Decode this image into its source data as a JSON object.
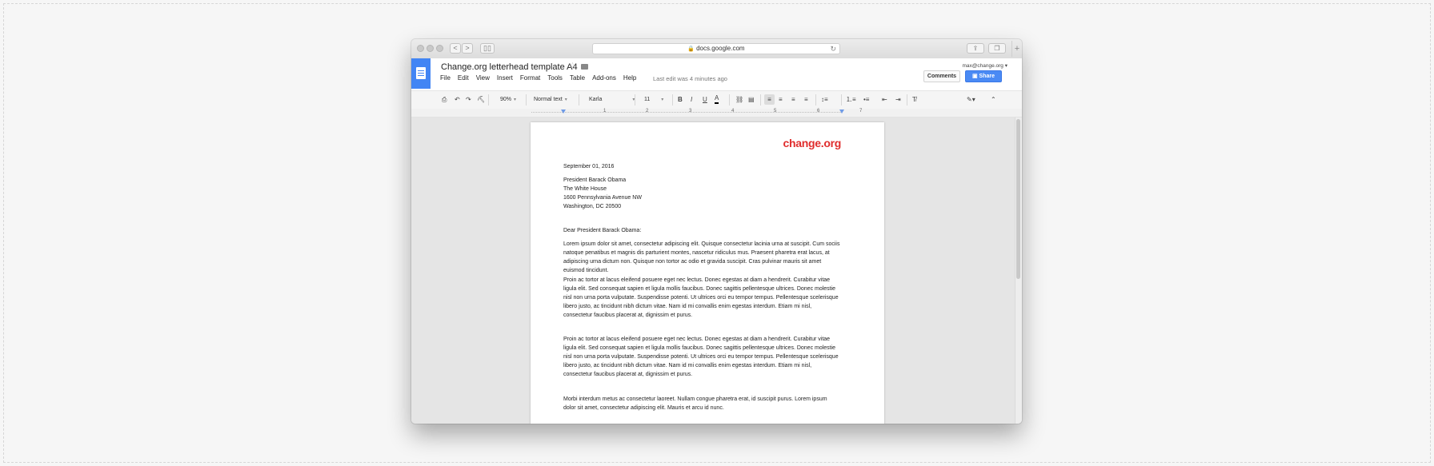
{
  "browser": {
    "url": "docs.google.com",
    "back_label": "<",
    "forward_label": ">"
  },
  "document": {
    "title": "Change.org letterhead template A4",
    "menu": [
      "File",
      "Edit",
      "View",
      "Insert",
      "Format",
      "Tools",
      "Table",
      "Add-ons",
      "Help"
    ],
    "last_edit": "Last edit was 4 minutes ago",
    "account": "max@change.org",
    "comments_label": "Comments",
    "share_label": "Share"
  },
  "toolbar": {
    "zoom": "90%",
    "style": "Normal text",
    "font": "Karla",
    "size": "11",
    "bold": "B",
    "italic": "I",
    "underline": "U",
    "text_color": "A"
  },
  "ruler": {
    "numbers": [
      "1",
      "2",
      "3",
      "4",
      "5",
      "6",
      "7"
    ]
  },
  "letter": {
    "brand": "change.org",
    "date": "September 01, 2016",
    "address": [
      "President Barack Obama",
      "The White House",
      "1600 Pennsylvania Avenue NW",
      "Washington, DC 20500"
    ],
    "greeting": "Dear President Barack Obama:",
    "paragraphs": [
      "Lorem ipsum dolor sit amet, consectetur adipiscing elit. Quisque consectetur lacinia urna at suscipit. Cum sociis natoque penatibus et magnis dis parturient montes, nascetur ridiculus mus. Praesent pharetra erat lacus, at adipiscing urna dictum non. Quisque non tortor ac odio et gravida suscipit. Cras pulvinar mauris sit amet euismod tincidunt.",
      "Proin ac tortor at lacus eleifend posuere eget nec lectus. Donec egestas at diam a hendrerit. Curabitur vitae ligula elit. Sed consequat sapien et ligula mollis faucibus. Donec sagittis pellentesque ultrices. Donec molestie nisl non urna porta vulputate. Suspendisse potenti. Ut ultrices orci eu tempor tempus. Pellentesque scelerisque libero justo, ac tincidunt nibh dictum vitae. Nam id mi convallis enim egestas interdum. Etiam mi nisl, consectetur faucibus placerat at, dignissim et purus.",
      "Proin ac tortor at lacus eleifend posuere eget nec lectus. Donec egestas at diam a hendrerit. Curabitur vitae ligula elit. Sed consequat sapien et ligula mollis faucibus. Donec sagittis pellentesque ultrices. Donec molestie nisl non urna porta vulputate. Suspendisse potenti. Ut ultrices orci eu tempor tempus. Pellentesque scelerisque libero justo, ac tincidunt nibh dictum vitae. Nam id mi convallis enim egestas interdum. Etiam mi nisl, consectetur faucibus placerat at, dignissim et purus.",
      "Morbi interdum metus ac consectetur laoreet. Nullam congue pharetra erat, id suscipit purus. Lorem ipsum dolor sit amet, consectetur adipiscing elit. Mauris et arcu id nunc."
    ]
  },
  "colors": {
    "brand_red": "#e02d2d",
    "share_blue": "#4a8af4",
    "docs_blue": "#4285f4"
  }
}
